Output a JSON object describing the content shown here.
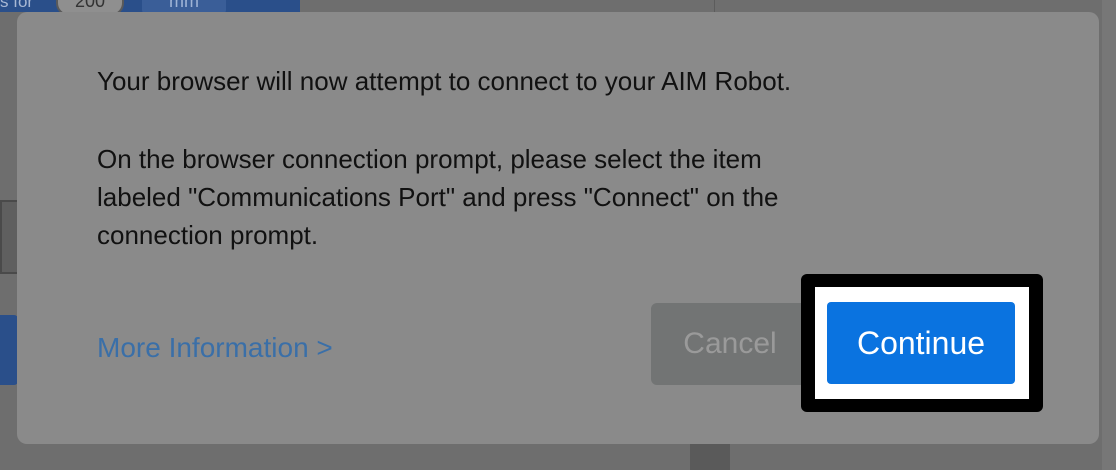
{
  "background": {
    "top_text_fragment": "s for",
    "top_pill_value": "200",
    "top_unit": "mm"
  },
  "dialog": {
    "message_line": "Your browser will now attempt to connect to your AIM Robot.",
    "instructions": "On the browser connection prompt, please select the item\nlabeled \"Communications Port\" and press \"Connect\" on the\nconnection prompt.",
    "more_info_link": "More Information >",
    "cancel_label": "Cancel",
    "continue_label": "Continue"
  },
  "colors": {
    "overlay": "#6e6e6e",
    "dialog_bg": "#8a8a8a",
    "link": "#3a6fa8",
    "continue_bg": "#0a73e0",
    "cancel_bg": "#727474",
    "highlight_frame": "#000000"
  }
}
